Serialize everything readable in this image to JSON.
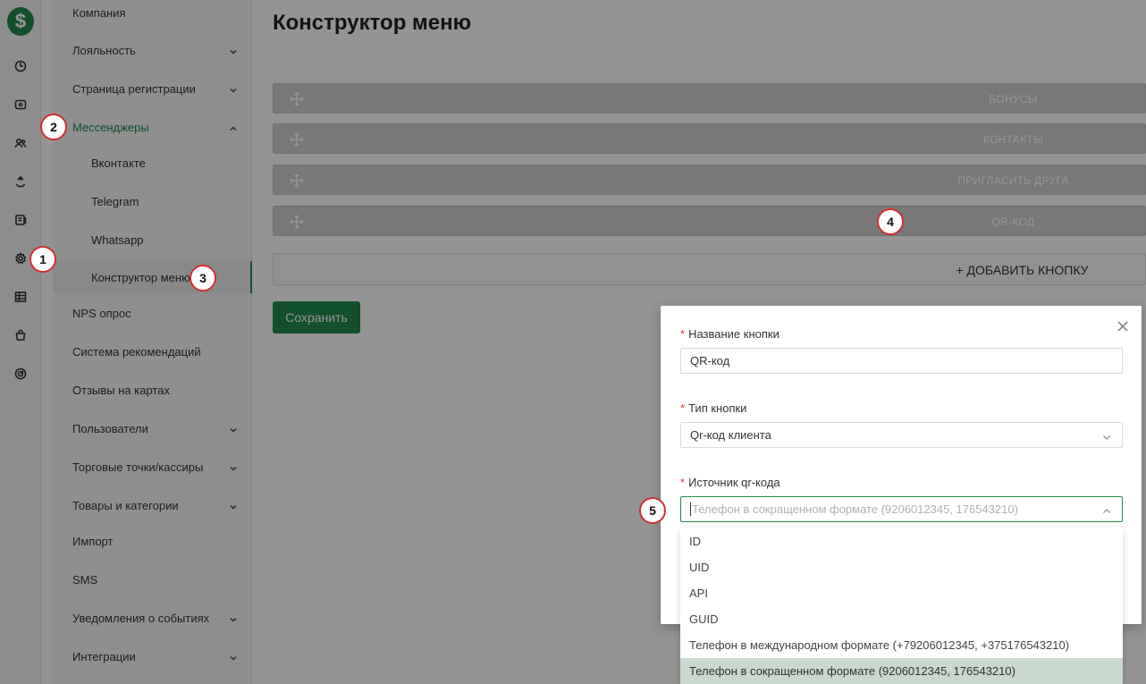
{
  "rail": {
    "logo": "$",
    "icons": [
      "dashboard-icon",
      "coupon-icon",
      "users-icon",
      "recycle-icon",
      "document-icon",
      "settings-icon",
      "table-icon",
      "bag-icon",
      "gauge-icon"
    ]
  },
  "sidebar": {
    "items": [
      {
        "label": "Компания"
      },
      {
        "label": "Лояльность"
      },
      {
        "label": "Страница регистрации"
      },
      {
        "label": "Мессенджеры"
      },
      {
        "label": "Вконтакте"
      },
      {
        "label": "Telegram"
      },
      {
        "label": "Whatsapp"
      },
      {
        "label": "Конструктор меню"
      },
      {
        "label": "NPS опрос"
      },
      {
        "label": "Система рекомендаций"
      },
      {
        "label": "Отзывы на картах"
      },
      {
        "label": "Пользователи"
      },
      {
        "label": "Торговые точки/кассиры"
      },
      {
        "label": "Товары и категории"
      },
      {
        "label": "Импорт"
      },
      {
        "label": "SMS"
      },
      {
        "label": "Уведомления о событиях"
      },
      {
        "label": "Интеграции"
      }
    ]
  },
  "main": {
    "title": "Конструктор меню",
    "menu_buttons": [
      "БОНУСЫ",
      "КОНТАКТЫ",
      "ПРИГЛАСИТЬ ДРУГА",
      "QR-КОД"
    ],
    "add_button": "+ ДОБАВИТЬ КНОПКУ",
    "save_button": "Сохранить"
  },
  "modal": {
    "name_label": "Название кнопки",
    "name_value": "QR-код",
    "type_label": "Тип кнопки",
    "type_value": "Qr-код клиента",
    "source_label": "Источник qr-кода",
    "source_placeholder": "Телефон в сокращенном формате (9206012345, 176543210)",
    "required_mark": "*",
    "options": [
      "ID",
      "UID",
      "API",
      "GUID",
      "Телефон в международном формате (+79206012345, +375176543210)",
      "Телефон в сокращенном формате (9206012345, 176543210)"
    ],
    "selected_option": "Телефон в сокращенном формате (9206012345, 176543210)"
  },
  "callouts": [
    "1",
    "2",
    "3",
    "4",
    "5"
  ],
  "colors": {
    "accent": "#1f8a4c",
    "callout_border": "#d32f2f",
    "selected_option_bg": "#c9d9cd"
  }
}
